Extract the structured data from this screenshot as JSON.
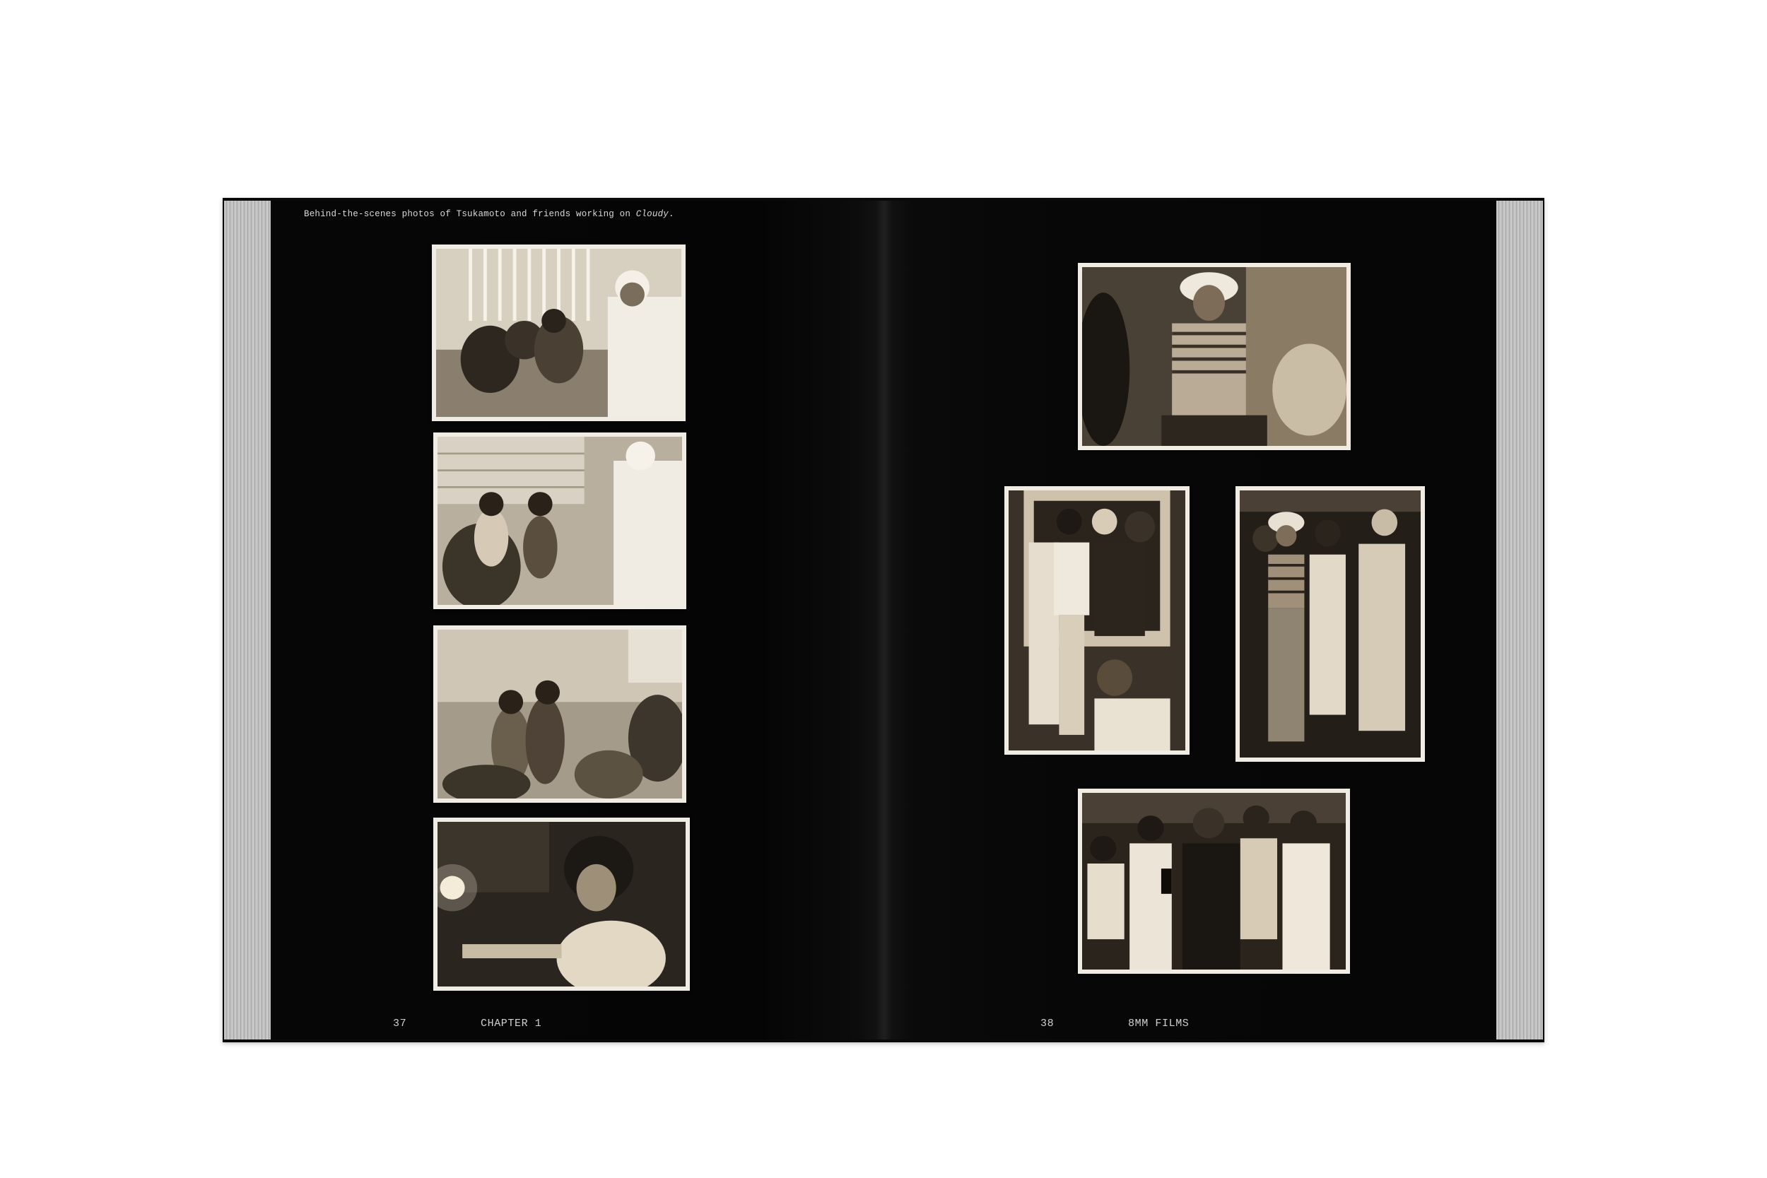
{
  "caption": {
    "text": "Behind-the-scenes photos of Tsukamoto and friends working on ",
    "title": "Cloudy",
    "end": "."
  },
  "left_page": {
    "page_number": "37",
    "running_head": "CHAPTER 1"
  },
  "right_page": {
    "page_number": "38",
    "running_head": "8MM FILMS"
  },
  "colors": {
    "page": "#060606",
    "paper": "#f1ece3",
    "sepia_light": "#efe6d6",
    "sepia_dark": "#1a150f"
  }
}
